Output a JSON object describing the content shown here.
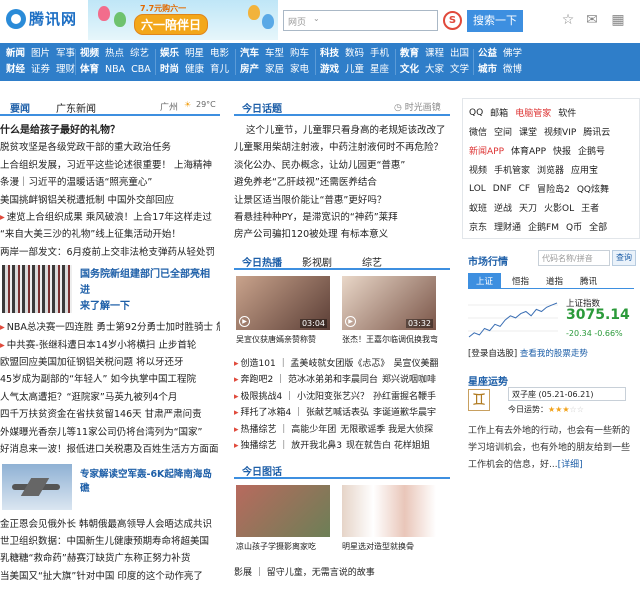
{
  "header": {
    "logo_text": "腾讯网",
    "banner_sub": "7.7元购六一",
    "banner_title": "六一陪伴日",
    "search": {
      "scope": "网页",
      "placeholder": "",
      "button": "搜索一下"
    },
    "search_engine_glyph": "S",
    "icons": [
      "star-icon",
      "mail-icon",
      "grid-icon"
    ]
  },
  "nav": {
    "groups": [
      {
        "rows": [
          [
            "新闻",
            "图片",
            "军事"
          ],
          [
            "财经",
            "证券",
            "理财"
          ]
        ]
      },
      {
        "rows": [
          [
            "视频",
            "热点",
            "综艺"
          ],
          [
            "体育",
            "NBA",
            "CBA"
          ]
        ]
      },
      {
        "rows": [
          [
            "娱乐",
            "明星",
            "电影"
          ],
          [
            "时尚",
            "健康",
            "育儿"
          ]
        ]
      },
      {
        "rows": [
          [
            "汽车",
            "车型",
            "购车"
          ],
          [
            "房产",
            "家居",
            "家电"
          ]
        ]
      },
      {
        "rows": [
          [
            "科技",
            "数码",
            "手机"
          ],
          [
            "游戏",
            "儿童",
            "星座"
          ]
        ]
      },
      {
        "rows": [
          [
            "教育",
            "课程",
            "出国"
          ],
          [
            "文化",
            "大家",
            "文学"
          ]
        ]
      },
      {
        "rows": [
          [
            "公益",
            "佛学"
          ],
          [
            "城市",
            "微博"
          ]
        ]
      }
    ]
  },
  "left": {
    "tabs": [
      "要闻",
      "广东新闻"
    ],
    "weather": {
      "city": "广州",
      "temp": "29°C"
    },
    "news_top": [
      {
        "text": "什么是给孩子最好的礼物？",
        "bold": true
      },
      {
        "text": "脱贫攻坚是各级党政干部的重大政治任务"
      },
      {
        "text": "上合组织发展，习近平这些论述很重要！ 上海精神"
      },
      {
        "text": "条漫｜习近平的温暖话语“照亮童心”"
      },
      {
        "text": "美国挑衅钢铝关税遭抵制 中国外交部回应"
      },
      {
        "text": "速览上合组织成果 乘风破浪！上合17年这样走过",
        "bullet": true
      },
      {
        "text": "“来自大美三沙的礼物”线上征集活动开始！"
      },
      {
        "text": "两岸一部发文：6月疫前上交非法枪支弹药从轻处罚"
      }
    ],
    "feature1": {
      "line1": "国务院新组建部门已全部亮相 进",
      "line2": "来了解一下"
    },
    "news_mid": [
      {
        "text": "NBA总决赛一四连胜 勇士第92分勇士加时胜骑士 詹皇51分",
        "bullet": true
      },
      {
        "text": "中共赛-张继科遭日本14岁小将横扫 止步首轮",
        "bullet": true
      },
      {
        "text": "欧盟回应美国加征钢铝关税问题 将以牙还牙"
      },
      {
        "text": "45岁成为副部的“年轻人” 如今执掌中国工程院"
      },
      {
        "text": "人气太高遭拒？“逛院家”马英九被列4个月"
      },
      {
        "text": "四千万扶贫资金在省扶贫留146天 甘肃严肃问责"
      },
      {
        "text": "外媒曝光香奈儿等11家公司仍将台湾列为“国家”"
      },
      {
        "text": "好消息来一波！报低进口关税惠及百姓生活方方面面"
      }
    ],
    "feature2": "专家解读空军轰-6K起降南海岛礁",
    "news_bottom": [
      "金正恩会见俄外长 韩朝俄最高领导人会晤达成共识",
      "世卫组织数据：中国新生儿健康预期寿命将超美国",
      "乳糖糖“救命药”赫赛汀缺货广东称正努力补货",
      "当美国又“扯大旗”针对中国 印度的这个动作亮了"
    ]
  },
  "mid": {
    "topic_tab": "今日话题",
    "topic_badge": "时光画镜",
    "topic_lines": [
      "这个儿童节，儿童罪只看身高的老规矩该改改了",
      "儿童聚用柴胡注射液，中药注射液何时不再危险？",
      "淡化公办、民办概念，让幼儿园更“普惠”",
      "避免养老“乙肝歧视”还需医养结合",
      "让景区适当限价能让“普惠”更好吗？",
      "看悬挂种种PY，是滞宽识的“神药”莱拜",
      "房产公司骗扣120被处理 有标本意义"
    ],
    "video_tabs": [
      "今日热播",
      "影视剧",
      "综艺"
    ],
    "videos": [
      {
        "caption": "吴宣仪获唐嫣亲赞称赞",
        "duration": "03:04"
      },
      {
        "caption": "张杰！王嘉尔临调侃换我弯",
        "duration": "03:32"
      }
    ],
    "video_list": [
      {
        "left": "创造101 ｜ 孟美岐就女团版《忐忑》",
        "right": "吴宣仪美翻"
      },
      {
        "left": "奔跑吧2 ｜ 范冰冰弟弟和李晨同台",
        "right": "郑兴说咽咖啡"
      },
      {
        "left": "极限挑战4 ｜ 小沈阳变张艺兴？",
        "right": "孙红雷握名鞭手"
      },
      {
        "left": "拜托了冰箱4 ｜ 张献艺喊话表弘",
        "right": "李诞道歉华晨宇"
      },
      {
        "left": "热播综艺 ｜ 高能少年团",
        "right": "无限歌谣季 我是大侦探"
      },
      {
        "left": "独播综艺 ｜ 放开我北鼻3",
        "right": "现在就告白 花样姐姐"
      }
    ],
    "pic_tab": "今日图话",
    "pics": [
      {
        "caption": "凉山孩子学摄影离家吃"
      },
      {
        "caption": "明星选对造型就换骨"
      }
    ],
    "pic_footer": "影展 ｜ 留守儿童，无需言说的故事"
  },
  "right": {
    "services": [
      [
        "QQ",
        "邮箱",
        "电脑管家",
        "软件"
      ],
      [
        "微信",
        "空间",
        "课堂",
        "视频VIP",
        "腾讯云"
      ],
      [
        "新闻APP",
        "体育APP",
        "快报",
        "企鹅号"
      ],
      [
        "视频",
        "手机管家",
        "浏览器",
        "应用宝"
      ],
      [
        "LOL",
        "DNF",
        "CF",
        "冒险岛2",
        "QQ炫舞"
      ],
      [
        "蚁班",
        "逆战",
        "天刀",
        "火影OL",
        "王者"
      ],
      [
        "京东",
        "理财通",
        "企鹅FM",
        "Q币",
        "全部"
      ]
    ],
    "market": {
      "title": "市场行情",
      "stock_placeholder": "代码名称/拼音",
      "query_btn": "查询",
      "tabs": [
        "上证",
        "恒指",
        "道指",
        "腾讯"
      ],
      "index_name": "上证指数",
      "index_value": "3075.14",
      "change": "-20.34",
      "change_pct": "-0.66%",
      "login_text": "[登录自选股]",
      "view_text": "查看我的股票走势",
      "chart_points": [
        12,
        14,
        13,
        16,
        15,
        18,
        17,
        20,
        22,
        21,
        23,
        24,
        22,
        25,
        24,
        26,
        27,
        28
      ]
    },
    "horoscope": {
      "title": "星座运势",
      "select": "双子座 (05.21-06.21)",
      "today_label": "今日运势：",
      "stars": 3,
      "text": "工作上有去外地的行动，也会有一些新的学习培训机会，也有外地的朋友给到一些工作机会的信息，好...",
      "detail": "[详细]"
    }
  }
}
